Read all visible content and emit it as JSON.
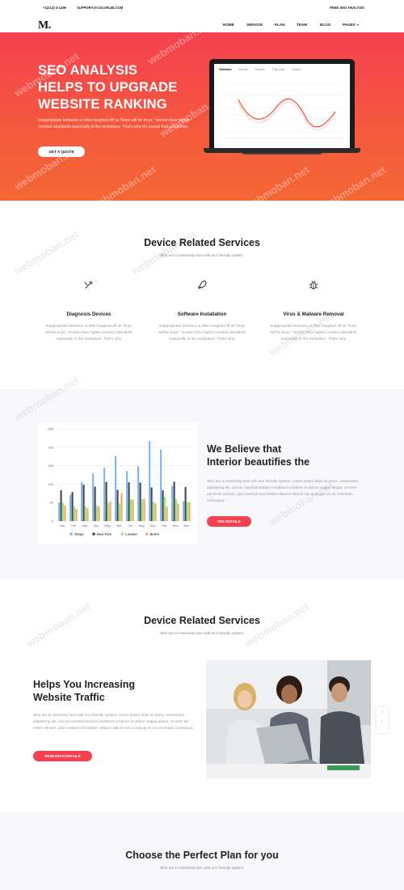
{
  "topbar": {
    "phone": "+1(212)-3-1296",
    "email": "SUPPORT@COLORLIB.COM",
    "right_link": "FREE SEO ANALYSIS"
  },
  "nav": {
    "logo": "M.",
    "links": [
      "HOME",
      "SERVICE",
      "PLAN",
      "TEAM",
      "BLOG",
      "PAGES"
    ]
  },
  "hero": {
    "title_lines": [
      "SEO ANALYSIS",
      "HELPS TO UPGRADE",
      "WEBSITE RANKING"
    ],
    "text": "Inappropriate behavior is often laughed off as \"boys will be boys,\" women face higher conduct standards especially in the workplace. That's why it's crucial that as women.",
    "button": "GET A QUOTE",
    "laptop_tabs": [
      "Statistics",
      "Activity",
      "Reports",
      "This week",
      "Search"
    ]
  },
  "watermark": "webmoban.net",
  "services": {
    "title": "Device Related Services",
    "subtitle": "Who are in extremely love with eco friendly system.",
    "items": [
      {
        "title": "Diagnosis Devices",
        "icon": "tools-icon",
        "text": "Inappropriate behavior is often laughed off as \"boys will be boys,\" women face higher conduct standards especially in the workplace. That's why"
      },
      {
        "title": "Software Installation",
        "icon": "rocket-icon",
        "text": "Inappropriate behavior is often laughed off as \"boys will be boys,\" women face higher conduct standards especially in the workplace. That's why"
      },
      {
        "title": "Virus & Malware Removal",
        "icon": "bug-icon",
        "text": "Inappropriate behavior is often laughed off as \"boys will be boys,\" women face higher conduct standards especially in the workplace. That's why"
      }
    ]
  },
  "believe": {
    "title_lines": [
      "We Believe that",
      "Interior beautifies the"
    ],
    "text": "Who are in extremely love with eco friendly system. Lorem ipsum dolor sit amet, consectetur adipisicing elit, sed do eiusmod tempor incididunt ut labore et dolore magna aliqua. Ut enim ad minim veniam, quis nostrud exercitation ullamco laboris nisi ut aliquip ex ea commodo consequat.",
    "button": "SEE DETAILS"
  },
  "chart_data": {
    "type": "bar",
    "categories": [
      "Jan",
      "Feb",
      "Mar",
      "Apr",
      "May",
      "Jun",
      "Jul",
      "Aug",
      "Sep",
      "Oct",
      "Nov",
      "Dec"
    ],
    "ylim": [
      0,
      250
    ],
    "yticks": [
      0,
      50,
      100,
      150,
      200,
      250
    ],
    "series": [
      {
        "name": "Tokyo",
        "color": "#7cb5ec",
        "values": [
          49.9,
          71.5,
          106.4,
          129.2,
          144.0,
          176.0,
          135.6,
          148.5,
          216.4,
          194.1,
          95.6,
          54.4
        ]
      },
      {
        "name": "New York",
        "color": "#434348",
        "values": [
          83.6,
          78.8,
          98.5,
          93.4,
          106.0,
          84.5,
          105.0,
          104.3,
          91.2,
          83.5,
          106.6,
          92.3
        ]
      },
      {
        "name": "London",
        "color": "#90ed7d",
        "values": [
          48.9,
          38.8,
          39.3,
          41.4,
          47.0,
          48.3,
          59.0,
          59.6,
          52.4,
          65.2,
          59.3,
          51.2
        ]
      },
      {
        "name": "Berlin",
        "color": "#f7a35c",
        "values": [
          42.4,
          33.2,
          34.5,
          39.7,
          52.6,
          75.5,
          57.4,
          60.4,
          47.6,
          39.1,
          46.8,
          51.1
        ]
      }
    ],
    "legend": "bottom"
  },
  "services2": {
    "title": "Device Related Services",
    "subtitle": "Who are in extremely love with eco friendly system."
  },
  "traffic": {
    "title_lines": [
      "Helps You Increasing",
      "Website Traffic"
    ],
    "text": "Who are in extremely love with eco friendly system. Lorem ipsum dolor sit amet, consectetur adipisicing elit, sed do eiusmod tempor incididunt ut labore et dolore magna aliqua. Ut enim ad minim veniam, quis nostrud exercitation ullamco laboris nisi ut aliquip ex ea commodo consequat.",
    "button": "RESEARCH DETAILS"
  },
  "plan": {
    "title": "Choose the Perfect Plan for you",
    "subtitle": "Who are in extremely love with eco friendly system."
  },
  "scroll": {
    "up": "↑",
    "down": "↓"
  }
}
